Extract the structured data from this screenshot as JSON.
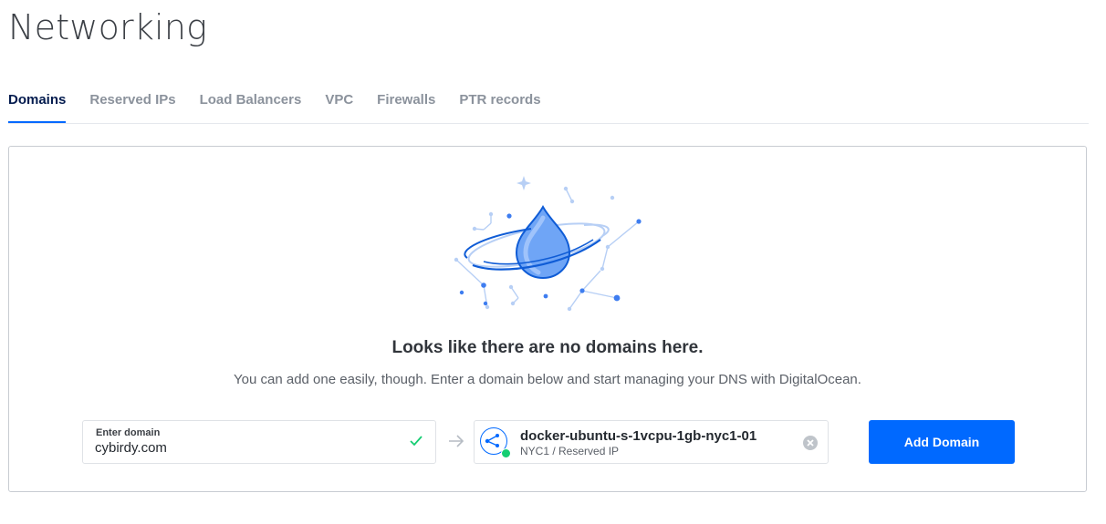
{
  "page": {
    "title": "Networking"
  },
  "tabs": [
    {
      "label": "Domains",
      "active": true
    },
    {
      "label": "Reserved IPs",
      "active": false
    },
    {
      "label": "Load Balancers",
      "active": false
    },
    {
      "label": "VPC",
      "active": false
    },
    {
      "label": "Firewalls",
      "active": false
    },
    {
      "label": "PTR records",
      "active": false
    }
  ],
  "empty_state": {
    "illustration": "droplet-planet-illustration",
    "heading": "Looks like there are no domains here.",
    "subtext": "You can add one easily, though. Enter a domain below and start managing your DNS with DigitalOcean."
  },
  "domain_form": {
    "label": "Enter domain",
    "value": "cybirdy.com",
    "valid_icon": "check-icon",
    "arrow_icon": "arrow-right-icon",
    "resource": {
      "name": "docker-ubuntu-s-1vcpu-1gb-nyc1-01",
      "subtitle": "NYC1 / Reserved IP",
      "icon": "reserved-ip-icon",
      "status_color": "#15cd72"
    },
    "clear_icon": "clear-icon",
    "add_button": "Add Domain"
  },
  "colors": {
    "accent": "#0069ff",
    "active_tab": "#031b4e",
    "inactive_tab": "#8b929c",
    "success": "#15cd72"
  }
}
